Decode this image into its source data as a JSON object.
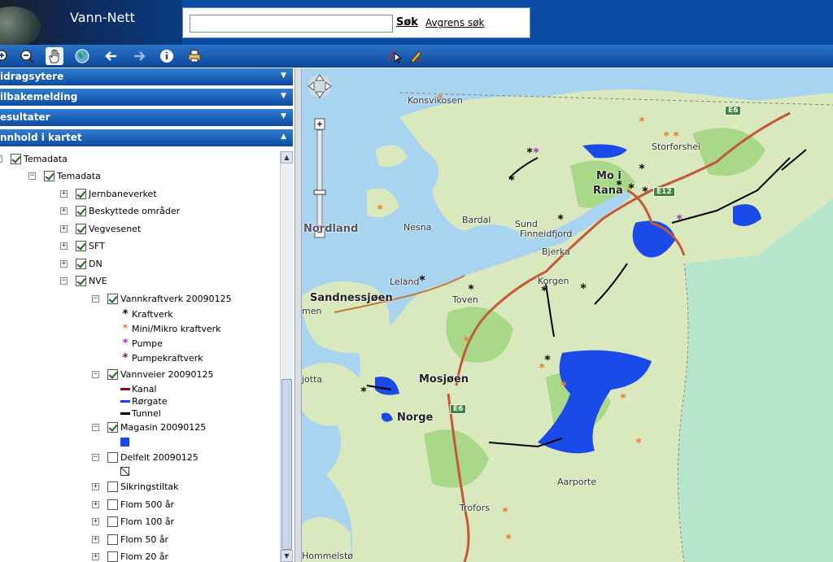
{
  "app": {
    "title": "Vann-Nett"
  },
  "search": {
    "value": "",
    "placeholder": "",
    "button_label": "Søk",
    "refine_label": "Avgrens søk"
  },
  "toolbar": {
    "tools": [
      "zoom-in-icon",
      "zoom-out-icon",
      "pan-hand-icon",
      "globe-icon",
      "back-arrow-icon",
      "forward-arrow-icon",
      "info-icon",
      "print-icon",
      "select-icon",
      "draw-icon"
    ]
  },
  "panels": [
    {
      "label": "Bidragsytere"
    },
    {
      "label": "Tilbakemelding"
    },
    {
      "label": "Resultater"
    },
    {
      "label": "Innhold i kartet"
    }
  ],
  "panels_visible": [
    "idragsytere",
    "ilbakemelding",
    "esultater",
    "nnhold i kartet"
  ],
  "tree": {
    "root": "Temadata",
    "temadata": "Temadata",
    "groups": [
      {
        "label": "Jernbaneverket"
      },
      {
        "label": "Beskyttede områder"
      },
      {
        "label": "Vegvesenet"
      },
      {
        "label": "SFT"
      },
      {
        "label": "DN"
      },
      {
        "label": "NVE"
      }
    ],
    "nve": {
      "vannkraftverk": "Vannkraftverk 20090125",
      "kraftverk_symbols": [
        {
          "label": "Kraftverk",
          "color": "#000000"
        },
        {
          "label": "Mini/Mikro kraftverk",
          "color": "#e8802a"
        },
        {
          "label": "Pumpe",
          "color": "#a030d0"
        },
        {
          "label": "Pumpekraftverk",
          "color": "#6a1a2a"
        }
      ],
      "vannveier": "Vannveier 20090125",
      "vannvei_symbols": [
        {
          "label": "Kanal",
          "color": "#8a1010"
        },
        {
          "label": "Rørgate",
          "color": "#1a40e0"
        },
        {
          "label": "Tunnel",
          "color": "#000000"
        }
      ],
      "magasin": "Magasin 20090125",
      "magasin_color": "#1a4ae8",
      "delfelt": "Delfelt 20090125"
    },
    "more": [
      {
        "label": "Sikringstiltak"
      },
      {
        "label": "Flom 500 år"
      },
      {
        "label": "Flom 100 år"
      },
      {
        "label": "Flom 50 år"
      },
      {
        "label": "Flom 20 år"
      }
    ]
  },
  "map": {
    "labels": {
      "konsvik": "Konsvikosen",
      "storforshei": "Storforshei",
      "moirana": "Mo i",
      "rana": "Rana",
      "nordland": "Nordland",
      "nesna": "Nesna",
      "bardal": "Bardal",
      "sund": "Sund",
      "finneidfjord": "Finneidfjord",
      "bjerka": "Bjerka",
      "leland": "Leland",
      "korgen": "Korgen",
      "sandnessjoen": "Sandnessjøen",
      "toven": "Toven",
      "mosjoen": "Mosjøen",
      "norge": "Norge",
      "aarporte": "Aarporte",
      "trofors": "Trofors",
      "hommelsto": "Hommelstø",
      "jotta": "jotta",
      "men": "men"
    },
    "shields": {
      "e6a": "E6",
      "e12": "E12",
      "e6b": "E6"
    },
    "colors": {
      "sea": "#a8d4f0",
      "land": "#d8e8c0",
      "sweden": "#b8e8d0",
      "roads": "#c0603a"
    }
  }
}
